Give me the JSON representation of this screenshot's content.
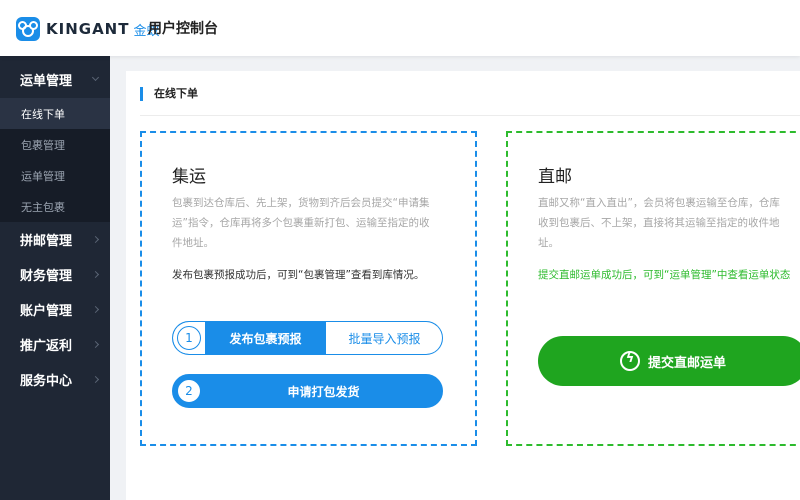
{
  "header": {
    "logo_text": "KINGANT",
    "logo_cn": "金蚁",
    "title": "用户控制台"
  },
  "sidebar": {
    "groups": [
      {
        "label": "运单管理",
        "open": true,
        "items": [
          {
            "label": "在线下单",
            "active": true
          },
          {
            "label": "包裹管理"
          },
          {
            "label": "运单管理"
          },
          {
            "label": "无主包裹"
          }
        ]
      },
      {
        "label": "拼邮管理"
      },
      {
        "label": "财务管理"
      },
      {
        "label": "账户管理"
      },
      {
        "label": "推广返利"
      },
      {
        "label": "服务中心"
      }
    ]
  },
  "main": {
    "panel_title": "在线下单",
    "consolidation": {
      "title": "集运",
      "description": "包裹到达仓库后、先上架，货物到齐后会员提交“申请集运”指令，仓库再将多个包裹重新打包、运输至指定的收件地址。",
      "note": "发布包裹预报成功后，可到“包裹管理”查看到库情况。",
      "step1_num": "1",
      "step1_primary": "发布包裹预报",
      "step1_secondary": "批量导入预报",
      "step2_num": "2",
      "step2_label": "申请打包发货"
    },
    "direct": {
      "title": "直邮",
      "description": "直邮又称“直入直出”，会员将包裹运输至仓库，仓库收到包裹后、不上架，直接将其运输至指定的收件地址。",
      "note": "提交直邮运单成功后，可到“运单管理”中查看运单状态",
      "submit_label": "提交直邮运单"
    }
  },
  "colors": {
    "accent_blue": "#1a8de8",
    "accent_green": "#1fa51f",
    "sidebar_bg": "#1f2735"
  }
}
